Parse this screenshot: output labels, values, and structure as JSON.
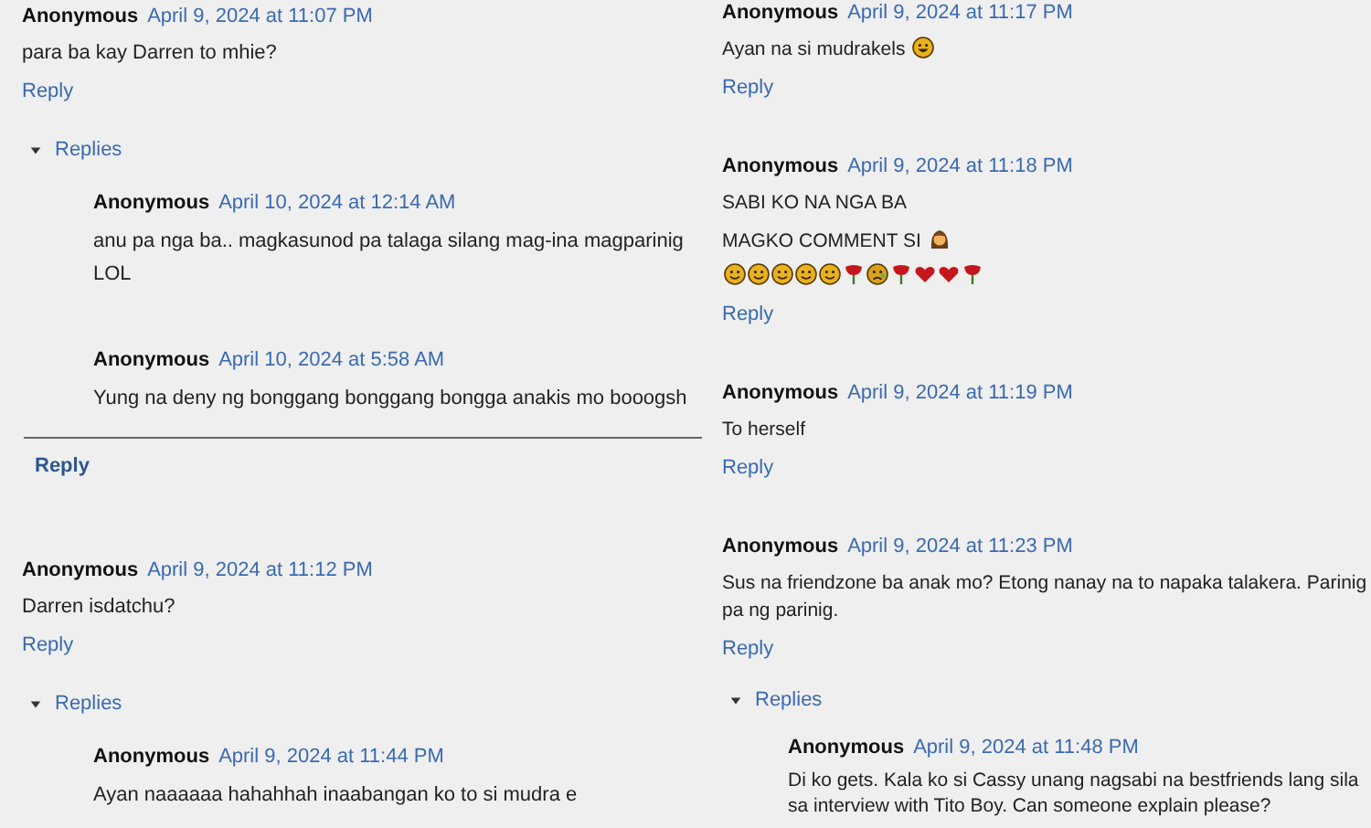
{
  "columns": [
    {
      "comments": [
        {
          "author": "Anonymous",
          "date": "April 9, 2024 at 11:07 PM",
          "paragraphs": [
            [
              {
                "text": "para ba kay Darren to mhie?"
              }
            ]
          ],
          "reply_link": "Reply",
          "replies_toggle": {
            "label": "Replies",
            "expanded": true
          },
          "replies": [
            {
              "author": "Anonymous",
              "date": "April 10, 2024 at 12:14 AM",
              "paragraphs": [
                [
                  {
                    "text": "anu pa nga ba.. magkasunod pa talaga silang mag-ina magparinig LOL"
                  }
                ]
              ]
            },
            {
              "author": "Anonymous",
              "date": "April 10, 2024 at 5:58 AM",
              "paragraphs": [
                [
                  {
                    "text": "Yung na deny ng bonggang bonggang bongga anakis mo booogsh"
                  }
                ]
              ]
            }
          ],
          "thread_reply": "Reply"
        },
        {
          "author": "Anonymous",
          "date": "April 9, 2024 at 11:12 PM",
          "paragraphs": [
            [
              {
                "text": "Darren isdatchu?"
              }
            ]
          ],
          "reply_link": "Reply",
          "replies_toggle": {
            "label": "Replies",
            "expanded": true
          },
          "replies": [
            {
              "author": "Anonymous",
              "date": "April 9, 2024 at 11:44 PM",
              "paragraphs": [
                [
                  {
                    "text": "Ayan naaaaaa hahahhah inaabangan ko to si mudra e"
                  }
                ]
              ]
            }
          ]
        }
      ]
    },
    {
      "comments": [
        {
          "author": "Anonymous",
          "date": "April 9, 2024 at 11:17 PM",
          "paragraphs": [
            [
              {
                "text": "Ayan na si mudrakels",
                "emojis": [
                  {
                    "kind": "laugh"
                  }
                ]
              }
            ]
          ],
          "reply_link": "Reply"
        },
        {
          "author": "Anonymous",
          "date": "April 9, 2024 at 11:18 PM",
          "paragraphs": [
            [
              {
                "text": "SABI KO NA NGA BA"
              }
            ],
            [
              {
                "text": "MAGKO COMMENT SI",
                "emojis": [
                  {
                    "kind": "woman"
                  }
                ]
              },
              {
                "emojis": [
                  {
                    "kind": "smile"
                  },
                  {
                    "kind": "smile"
                  },
                  {
                    "kind": "smile"
                  },
                  {
                    "kind": "smile"
                  },
                  {
                    "kind": "smile"
                  },
                  {
                    "kind": "rose"
                  },
                  {
                    "kind": "sad"
                  },
                  {
                    "kind": "rose"
                  },
                  {
                    "kind": "heart"
                  },
                  {
                    "kind": "heart"
                  },
                  {
                    "kind": "rose"
                  }
                ]
              }
            ]
          ],
          "reply_link": "Reply"
        },
        {
          "author": "Anonymous",
          "date": "April 9, 2024 at 11:19 PM",
          "paragraphs": [
            [
              {
                "text": "To herself"
              }
            ]
          ],
          "reply_link": "Reply"
        },
        {
          "author": "Anonymous",
          "date": "April 9, 2024 at 11:23 PM",
          "paragraphs": [
            [
              {
                "text": "Sus na friendzone ba anak mo? Etong nanay na to napaka talakera. Parinig pa ng parinig."
              }
            ]
          ],
          "reply_link": "Reply",
          "replies_toggle": {
            "label": "Replies",
            "expanded": true
          },
          "replies": [
            {
              "author": "Anonymous",
              "date": "April 9, 2024 at 11:48 PM",
              "paragraphs": [
                [
                  {
                    "text": "Di ko gets. Kala ko si Cassy unang nagsabi na bestfriends lang sila sa interview with Tito Boy. Can someone explain please?"
                  }
                ]
              ]
            }
          ]
        }
      ]
    }
  ]
}
